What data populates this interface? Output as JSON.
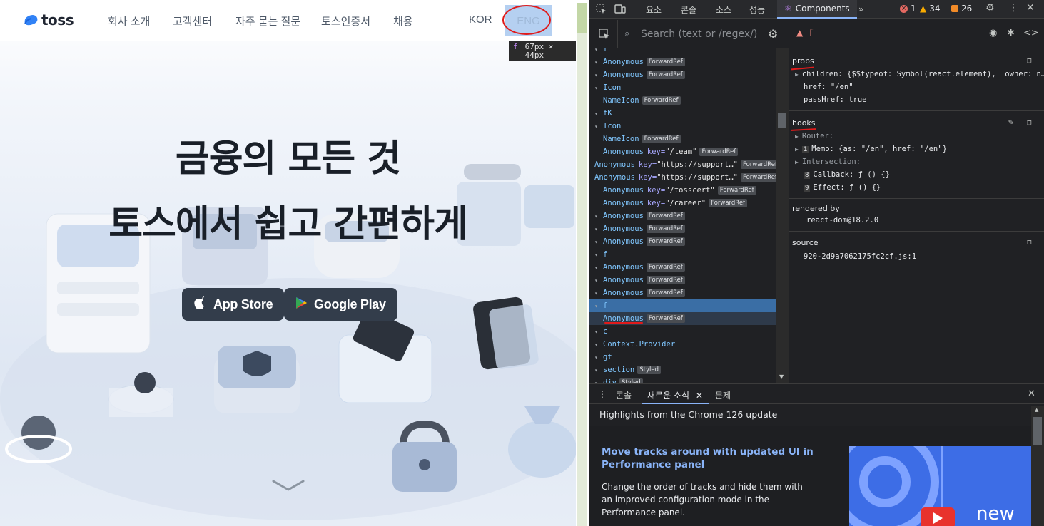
{
  "site": {
    "logo_text": "toss",
    "nav": [
      "회사 소개",
      "고객센터",
      "자주 묻는 질문",
      "토스인증서",
      "채용"
    ],
    "lang_kor": "KOR",
    "lang_eng": "ENG",
    "size_tip": {
      "tag": "f",
      "size": "67px × 44px"
    },
    "hero_line1": "금융의 모든 것",
    "hero_line2": "토스에서 쉽고 간편하게",
    "app_store": "App Store",
    "google_play": "Google Play"
  },
  "devtools": {
    "tabs": [
      "요소",
      "콘솔",
      "소스",
      "성능",
      "Components"
    ],
    "more_tabs": "»",
    "counts": {
      "errors": "1",
      "warnings": "34",
      "issues": "26"
    },
    "search_placeholder": "Search (text or /regex/)",
    "selected_name": "f",
    "tree": [
      {
        "name": "f",
        "tag": "",
        "key": "",
        "indent": 0,
        "arrow": "▾"
      },
      {
        "name": "Anonymous",
        "tag": "ForwardRef",
        "key": "",
        "indent": 1,
        "arrow": "▾"
      },
      {
        "name": "Anonymous",
        "tag": "ForwardRef",
        "key": "",
        "indent": 1,
        "arrow": "▾"
      },
      {
        "name": "Icon",
        "tag": "",
        "key": "",
        "indent": 1,
        "arrow": "▾"
      },
      {
        "name": "NameIcon",
        "tag": "ForwardRef",
        "key": "",
        "indent": 2,
        "arrow": ""
      },
      {
        "name": "fK",
        "tag": "",
        "key": "",
        "indent": 1,
        "arrow": "▾"
      },
      {
        "name": "Icon",
        "tag": "",
        "key": "",
        "indent": 1,
        "arrow": "▾"
      },
      {
        "name": "NameIcon",
        "tag": "ForwardRef",
        "key": "",
        "indent": 2,
        "arrow": ""
      },
      {
        "name": "Anonymous",
        "tag": "ForwardRef",
        "key": "\"/team\"",
        "indent": 2,
        "arrow": ""
      },
      {
        "name": "Anonymous",
        "tag": "ForwardRef",
        "key": "\"https://support…\"",
        "indent": 2,
        "arrow": ""
      },
      {
        "name": "Anonymous",
        "tag": "ForwardRef",
        "key": "\"https://support…\"",
        "indent": 2,
        "arrow": ""
      },
      {
        "name": "Anonymous",
        "tag": "ForwardRef",
        "key": "\"/tosscert\"",
        "indent": 2,
        "arrow": ""
      },
      {
        "name": "Anonymous",
        "tag": "ForwardRef",
        "key": "\"/career\"",
        "indent": 2,
        "arrow": ""
      },
      {
        "name": "Anonymous",
        "tag": "ForwardRef",
        "key": "",
        "indent": 1,
        "arrow": "▾"
      },
      {
        "name": "Anonymous",
        "tag": "ForwardRef",
        "key": "",
        "indent": 1,
        "arrow": "▾"
      },
      {
        "name": "Anonymous",
        "tag": "ForwardRef",
        "key": "",
        "indent": 1,
        "arrow": "▾"
      },
      {
        "name": "f",
        "tag": "",
        "key": "",
        "indent": 1,
        "arrow": "▾"
      },
      {
        "name": "Anonymous",
        "tag": "ForwardRef",
        "key": "",
        "indent": 1,
        "arrow": "▾"
      },
      {
        "name": "Anonymous",
        "tag": "ForwardRef",
        "key": "",
        "indent": 1,
        "arrow": "▾"
      },
      {
        "name": "Anonymous",
        "tag": "ForwardRef",
        "key": "",
        "indent": 1,
        "arrow": "▾"
      },
      {
        "name": "f",
        "tag": "",
        "key": "",
        "indent": 1,
        "arrow": "▾",
        "selected": true
      },
      {
        "name": "Anonymous",
        "tag": "ForwardRef",
        "key": "",
        "indent": 1,
        "arrow": "",
        "hover": true
      },
      {
        "name": "c",
        "tag": "",
        "key": "",
        "indent": 1,
        "arrow": "▾"
      },
      {
        "name": "Context.Provider",
        "tag": "",
        "key": "",
        "indent": 1,
        "arrow": "▾"
      },
      {
        "name": "gt",
        "tag": "",
        "key": "",
        "indent": 1,
        "arrow": "▾"
      },
      {
        "name": "section",
        "tag": "Styled",
        "key": "",
        "indent": 1,
        "arrow": "▾"
      },
      {
        "name": "div",
        "tag": "Styled",
        "key": "",
        "indent": 1,
        "arrow": "▾"
      }
    ],
    "props": {
      "title": "props",
      "children": "children: {$$typeof: Symbol(react.element), _owner: n…",
      "href": "href: \"/en\"",
      "passHref": "passHref: true"
    },
    "hooks": {
      "title": "hooks",
      "router": "Router:",
      "memo": "Memo: {as: \"/en\", href: \"/en\"}",
      "intersection": "Intersection:",
      "callback": "Callback: ƒ () {}",
      "effect": "Effect: ƒ () {}",
      "memo_id": "1",
      "callback_id": "8",
      "effect_id": "9"
    },
    "rendered_by": {
      "title": "rendered by",
      "value": "react-dom@18.2.0"
    },
    "source": {
      "title": "source",
      "value": "920-2d9a7062175fc2cf.js:1"
    },
    "drawer": {
      "tabs": [
        "콘솔",
        "새로운 소식",
        "문제"
      ],
      "headline": "Highlights from the Chrome 126 update",
      "article_title": "Move tracks around with updated UI in Performance panel",
      "article_body": "Change the order of tracks and hide them with an improved configuration mode in the Performance panel.",
      "image_text": "new"
    },
    "colors": {
      "accent": "#8ab4f8",
      "selected_row": "#3a6ea5",
      "annotation_red": "#e01b1b"
    }
  }
}
